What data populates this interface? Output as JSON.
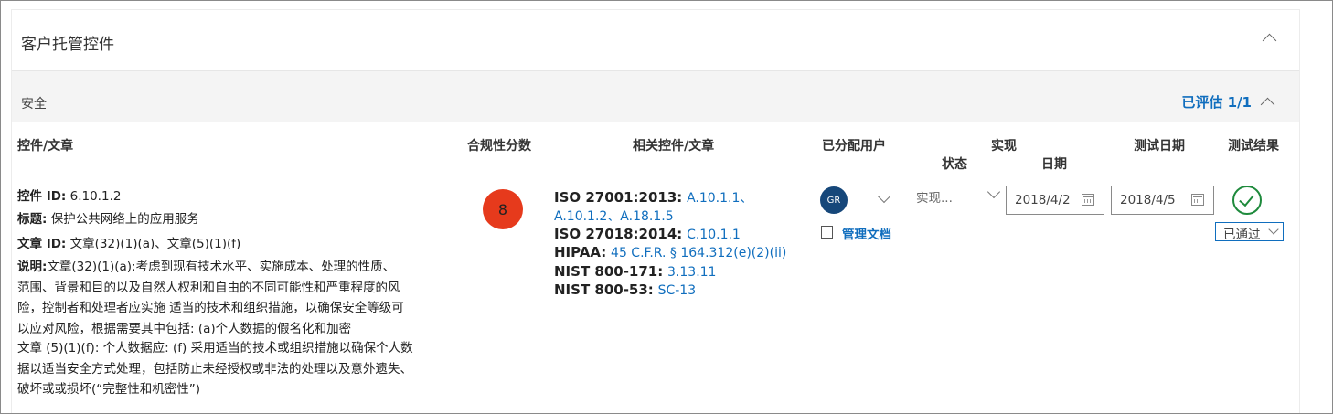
{
  "section": {
    "title": "客户托管控件"
  },
  "group": {
    "title": "安全",
    "evaluated": "已评估 1/1"
  },
  "headers": {
    "control": "控件/文章",
    "score": "合规性分数",
    "related": "相关控件/文章",
    "assigned": "已分配用户",
    "impl": "实现",
    "impl_state": "状态",
    "impl_date": "日期",
    "test_date": "测试日期",
    "test_result": "测试结果"
  },
  "row": {
    "control_id_label": "控件 ID:",
    "control_id": "6.10.1.2",
    "title_label": "标题:",
    "title": "保护公共网络上的应用服务",
    "article_id_label": "文章 ID:",
    "article_id": "文章(32)(1)(a)、文章(5)(1)(f)",
    "desc_label": "说明:",
    "desc_lines": [
      "文章(32)(1)(a):考虑到现有技术水平、实施成本、处理的性质、",
      "范围、背景和目的以及自然人权利和自由的不同可能性和严重程度的风",
      "险，控制者和处理者应实施 适当的技术和组织措施，以确保安全等级可",
      "以应对风险，根据需要其中包括: (a)个人数据的假名化和加密"
    ],
    "desc2_lines": [
      "文章 (5)(1)(f): 个人数据应: (f) 采用适当的技术或组织措施以确保个人数",
      "据以适当安全方式处理，包括防止未经授权或非法的处理以及意外遗失、",
      "破坏或或损坏(“完整性和机密性”)"
    ],
    "score": "8",
    "related": [
      {
        "std": "ISO 27001:2013:",
        "refs": "A.10.1.1、"
      },
      {
        "std": "",
        "refs": "A.10.1.2、A.18.1.5"
      },
      {
        "std": "ISO 27018:2014:",
        "refs": "C.10.1.1"
      },
      {
        "std": "HIPAA:",
        "refs": "45 C.F.R. § 164.312(e)(2)(ii)"
      },
      {
        "std": "NIST 800-171:",
        "refs": "3.13.11"
      },
      {
        "std": "NIST 800-53:",
        "refs": "SC-13"
      }
    ],
    "user_initials": "GR",
    "manage_docs": "管理文档",
    "impl_state": "实现...",
    "impl_date": "2018/4/2",
    "test_date": "2018/4/5",
    "test_result": "已通过"
  },
  "colors": {
    "accent": "#106ebe",
    "score_badge": "#e63a1c",
    "pass": "#1e8a3c",
    "avatar": "#16477a"
  },
  "icons": [
    "chevron-up-icon",
    "chevron-down-icon",
    "calendar-icon",
    "document-icon",
    "checkmark-circle-icon"
  ]
}
